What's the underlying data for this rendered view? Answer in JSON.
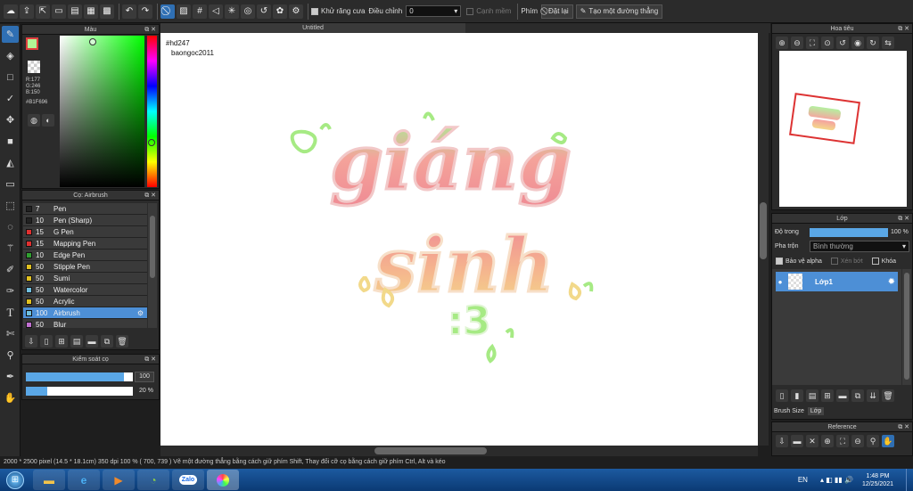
{
  "app": {
    "canvas_title": "Untitled"
  },
  "toolbar": {
    "antialias_label": "Khử răng cưa",
    "adjust_label": "Điều chỉnh",
    "adjust_value": "0",
    "edge_label": "Cạnh mềm",
    "key_label": "Phím",
    "reset_label": "Đặt lại",
    "line_label": "Tạo một đường thẳng"
  },
  "color_panel": {
    "title": "Màu",
    "r": "R:177",
    "g": "G:246",
    "b": "B:150",
    "hex": "#B1F696",
    "current_color": "#b1f696"
  },
  "brush_panel": {
    "title": "Cọ: Airbrush",
    "items": [
      {
        "size": "7",
        "name": "Pen",
        "color": "#222222",
        "selected": false
      },
      {
        "size": "10",
        "name": "Pen (Sharp)",
        "color": "#222222",
        "selected": false
      },
      {
        "size": "15",
        "name": "G Pen",
        "color": "#e03030",
        "selected": false
      },
      {
        "size": "15",
        "name": "Mapping Pen",
        "color": "#e03030",
        "selected": false
      },
      {
        "size": "10",
        "name": "Edge Pen",
        "color": "#30a030",
        "selected": false
      },
      {
        "size": "50",
        "name": "Stipple Pen",
        "color": "#e0c020",
        "selected": false
      },
      {
        "size": "50",
        "name": "Sumi",
        "color": "#e0c020",
        "selected": false
      },
      {
        "size": "50",
        "name": "Watercolor",
        "color": "#70c0e0",
        "selected": false
      },
      {
        "size": "50",
        "name": "Acrylic",
        "color": "#e0c020",
        "selected": false
      },
      {
        "size": "100",
        "name": "Airbrush",
        "color": "#70c0e0",
        "selected": true
      },
      {
        "size": "50",
        "name": "Blur",
        "color": "#c070d0",
        "selected": false
      }
    ]
  },
  "brush_control": {
    "title": "Kiểm soát cọ",
    "size_value": "100",
    "opacity_value": "20 %",
    "size_fraction": 0.92,
    "opacity_fraction": 0.2
  },
  "canvas": {
    "note_line1": "#hd247",
    "note_line2": "baongoc2011",
    "art_word1": "giáng",
    "art_word2": "sinh",
    "art_word3": ":3"
  },
  "navigator": {
    "title": "Hoa tiêu"
  },
  "layer_panel": {
    "title": "Lớp",
    "opacity_label": "Độ trong",
    "opacity_value": "100 %",
    "blend_label": "Pha trộn",
    "blend_value": "Bình thường",
    "protect_alpha_label": "Bảo vệ alpha",
    "clip_label": "Xén bớt",
    "lock_label": "Khóa",
    "layer_name": "Lớp1",
    "brush_size_label": "Brush Size",
    "brush_size_tab": "Lớp"
  },
  "reference_panel": {
    "title": "Reference"
  },
  "status": {
    "text": "2000 * 2500 pixel  (14.5 * 18.1cm)  350 dpi  100 %  ( 700, 739 )  Vẽ một đường thẳng bằng cách giữ phím Shift, Thay đổi cỡ cọ bằng cách giữ phím Ctrl, Alt và kéo"
  },
  "taskbar": {
    "lang": "EN",
    "time": "1:48 PM",
    "date": "12/25/2021",
    "zalo_label": "Zalo"
  }
}
